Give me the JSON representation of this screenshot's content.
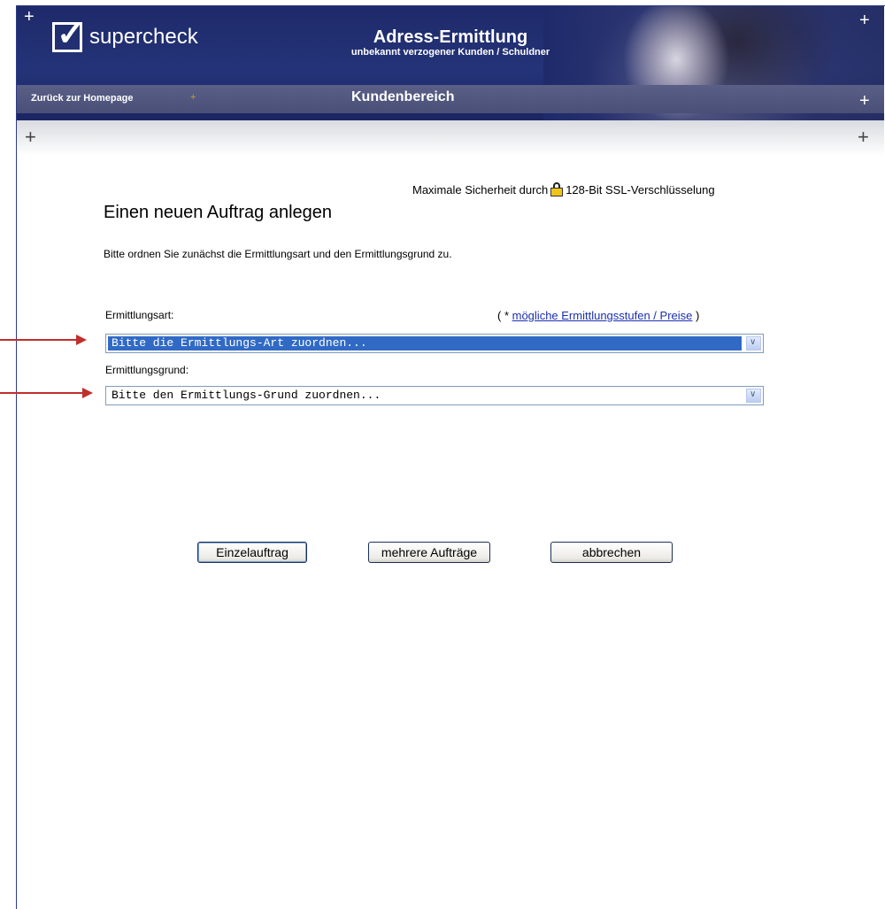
{
  "header": {
    "logo_text": "supercheck",
    "title": "Adress-Ermittlung",
    "subtitle": "unbekannt verzogener Kunden / Schuldner",
    "plus_glyph": "+"
  },
  "nav": {
    "back_link": "Zurück zur Homepage",
    "marker": "+",
    "section_title": "Kundenbereich"
  },
  "security": {
    "prefix": "Maximale Sicherheit durch",
    "suffix": "128-Bit SSL-Verschlüsselung",
    "icon": "lock-icon"
  },
  "main": {
    "title": "Einen neuen Auftrag anlegen",
    "intro": "Bitte ordnen Sie zunächst die Ermittlungsart und den Ermittlungsgrund zu."
  },
  "form": {
    "art_label": "Ermittlungsart:",
    "link_prefix": "( * ",
    "link_text": "mögliche Ermittlungsstufen / Preise",
    "link_suffix": " )",
    "art_value": "Bitte die Ermittlungs-Art zuordnen...",
    "grund_label": "Ermittlungsgrund:",
    "grund_value": "Bitte den Ermittlungs-Grund zuordnen..."
  },
  "buttons": {
    "single": "Einzelauftrag",
    "multiple": "mehrere Aufträge",
    "cancel": "abbrechen"
  },
  "colors": {
    "header_bg": "#243378",
    "link": "#1b2fb0",
    "highlight": "#316ac5",
    "annotation_arrow": "#c0302b"
  }
}
